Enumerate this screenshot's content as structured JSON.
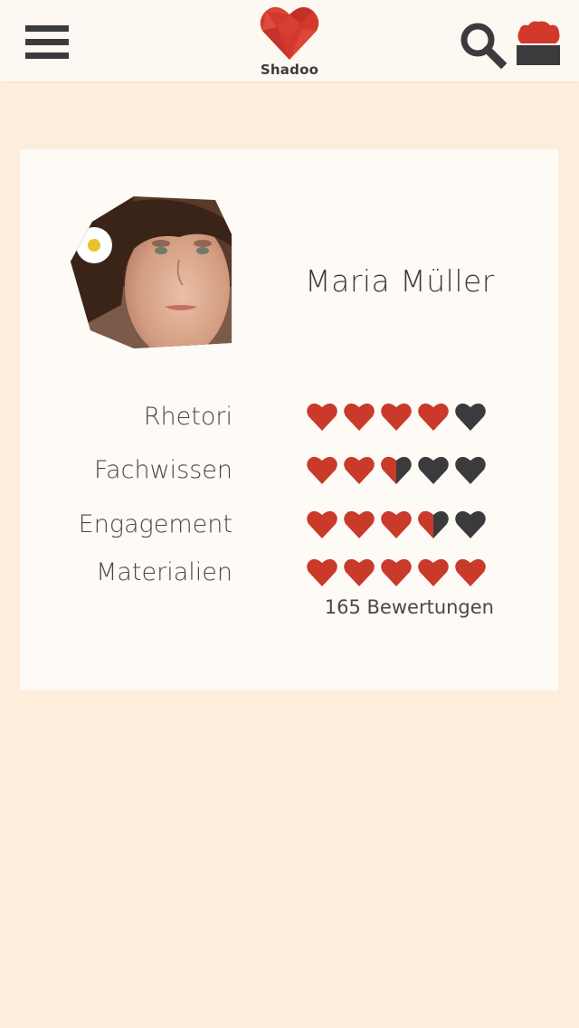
{
  "header": {
    "logo_text": "Shadoo",
    "brand_color": "#d3382c",
    "icon_color": "#3b3b3d"
  },
  "profile": {
    "name": "Maria Müller",
    "avatar": "portrait-photo"
  },
  "ratings": [
    {
      "label": "Rhetori",
      "value": 4.0,
      "max": 5
    },
    {
      "label": "Fachwissen",
      "value": 2.5,
      "max": 5
    },
    {
      "label": "Engagement",
      "value": 3.5,
      "max": 5
    },
    {
      "label": "Materialien",
      "value": 5.0,
      "max": 5
    }
  ],
  "review_count_text": "165 Bewertungen",
  "colors": {
    "background": "#fdeedb",
    "card": "#fefaf5",
    "heart_filled": "#c93a2b",
    "heart_empty": "#3b3b3d"
  }
}
